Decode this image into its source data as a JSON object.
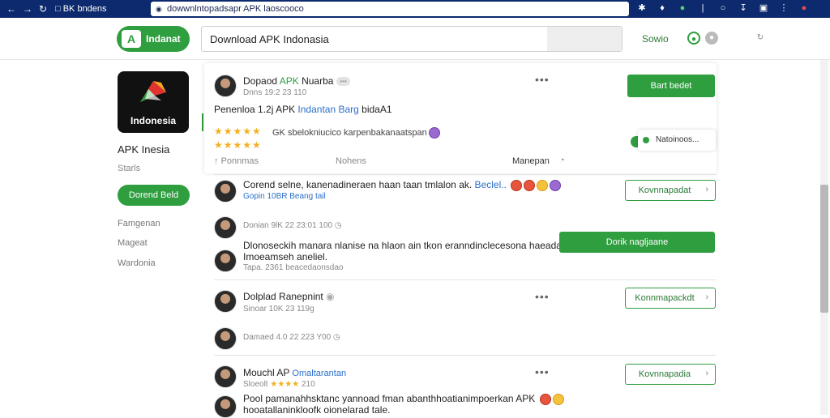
{
  "browser": {
    "tab_title": "ВK bndens",
    "address": "dowwnlntopadsapr APK laoscooco"
  },
  "header": {
    "logo_label": "Indanat",
    "search_value": "Download APK Indonasia",
    "link_label": "Sowio"
  },
  "sidebar": {
    "app_icon_label": "Indonesia",
    "app_name": "APK Inesia",
    "app_sub": "Starls",
    "button_label": "Dorend Beld",
    "links": [
      "Famgenan",
      "Mageat",
      "Wardonia"
    ]
  },
  "post": {
    "title_a": "Dopaod ",
    "title_b": "APK",
    "title_c": " Nuarba",
    "badge": "•••",
    "meta": "Dnns 19:2 23 110",
    "body_a": "Penenloa 1.2j APK ",
    "body_b": "Indantan Barg",
    "body_c": " bidaA1",
    "stars_1": "★★★★★",
    "rating_text": "GK sbelokniucico karpenbakanaatspan",
    "stars_2": "★★★★★",
    "action_1": "Ponnmas",
    "action_2": "Nohens",
    "action_3": "Manepan",
    "primary_button": "Bart bedet",
    "toggle_label": "Natoinoos..."
  },
  "comments": [
    {
      "text_a": "Corend selne, kanenadineraen haan taan tmlalon ak. ",
      "text_b": "Beclel..",
      "meta": "Gopin 10BR Beang tail",
      "button": "Kovnnapadat"
    },
    {
      "meta": "Donian 9lK 22 23:01 100",
      "text": "Dlonoseckih manara nlanise na hlaon ain tkon eranndinclecesona haeada Pi..."
    },
    {
      "text": "Imoeamseh aneliel.",
      "meta": "Tapa. 2361 beacedaonsdao",
      "button": "Dorik nagljaane"
    },
    {
      "title": "Dolplad Ranepnint",
      "meta": "Sinoar 10K 23 119g",
      "button": "Konnmapackdt"
    },
    {
      "meta": "Damaed 4.0 22 223 Y00"
    },
    {
      "title": "Mouchl AP",
      "title_b": " Omaltarantan",
      "meta_a": "Sloeolt ",
      "meta_stars": "★★★★",
      "meta_b": " 210",
      "text": "Pool pamanahhsktanc yannoad fman abanthhoatianimpoerkan APK",
      "text_2": "hooatallaninkloofk oionelarad tale.",
      "button": "Kovnnapadia"
    }
  ],
  "colors": {
    "brand_green": "#2e9e3f",
    "chrome_blue": "#0d2a6e",
    "star_yellow": "#f2b01e"
  }
}
